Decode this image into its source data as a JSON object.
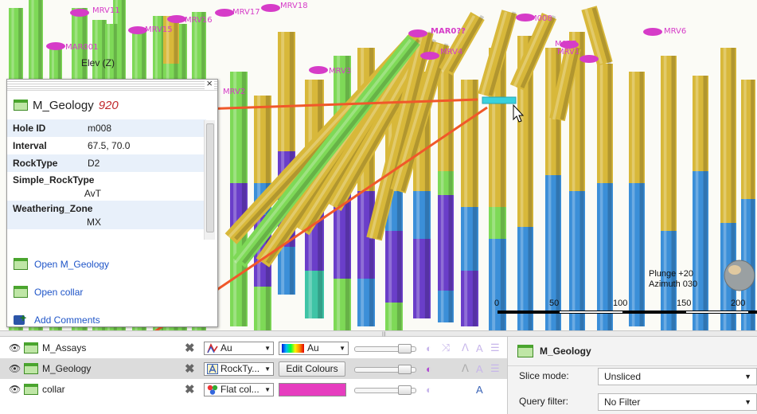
{
  "viewport": {
    "well_labels": [
      {
        "id": "mrv11",
        "text": "MRV11",
        "bold": false
      },
      {
        "id": "mrv15",
        "text": "MRV15",
        "bold": false
      },
      {
        "id": "mrv16",
        "text": "MRV16",
        "bold": false
      },
      {
        "id": "mrv17",
        "text": "MRV17",
        "bold": false
      },
      {
        "id": "mrv18",
        "text": "MRV18",
        "bold": false
      },
      {
        "id": "mar001",
        "text": "MAR001",
        "bold": false
      },
      {
        "id": "mar0xx",
        "text": "MAR0??",
        "bold": true
      },
      {
        "id": "mrv4",
        "text": "MRV4",
        "bold": false
      },
      {
        "id": "m008",
        "text": "M008",
        "bold": false
      },
      {
        "id": "m007",
        "text": "M007",
        "bold": false
      },
      {
        "id": "mrv3",
        "text": "MRV3",
        "bold": false
      },
      {
        "id": "mrv2",
        "text": "MRV2",
        "bold": false
      },
      {
        "id": "mrv6",
        "text": "MRV6",
        "bold": false
      },
      {
        "id": "mrv1",
        "text": "MRV1",
        "bold": false
      }
    ],
    "elev_label": "Elev (Z)",
    "orientation": {
      "plunge": "Plunge +20",
      "azimuth": "Azimuth 030"
    },
    "scale_ticks": [
      "0",
      "50",
      "100",
      "150",
      "200"
    ],
    "colors": {
      "yellow": "#d8b83a",
      "green": "#7ed957",
      "blue": "#3b8fd8",
      "purple": "#6a3ec9",
      "teal": "#3fc4a6",
      "magenta": "#d63cc8",
      "arrow": "#f0582a"
    }
  },
  "popup": {
    "close_glyph": "×",
    "title": "M_Geology",
    "title_number": "920",
    "attributes": [
      {
        "key": "Hole ID",
        "value": "m008"
      },
      {
        "key": "Interval",
        "value": "67.5, 70.0"
      },
      {
        "key": "RockType",
        "value": "D2"
      }
    ],
    "attributes_multiline": [
      {
        "key": "Simple_RockType",
        "value": "AvT"
      },
      {
        "key": "Weathering_Zone",
        "value": "MX"
      }
    ],
    "links": {
      "open_table": "Open M_Geology",
      "open_collar": "Open collar",
      "add_comments": "Add Comments"
    }
  },
  "layers": [
    {
      "name": "M_Assays",
      "column": "Au",
      "color_label": "Au"
    },
    {
      "name": "M_Geology",
      "column": "RockTy...",
      "color_label": "Edit Colours"
    },
    {
      "name": "collar",
      "column": "Flat col...",
      "color_label": ""
    }
  ],
  "properties": {
    "title": "M_Geology",
    "slice_mode_label": "Slice mode:",
    "slice_mode_value": "Unsliced",
    "query_filter_label": "Query filter:",
    "query_filter_value": "No Filter"
  }
}
